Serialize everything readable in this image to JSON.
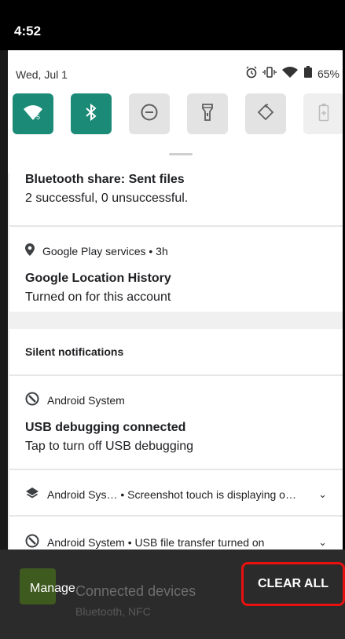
{
  "status_bar": {
    "time": "4:52"
  },
  "quick_settings": {
    "date": "Wed, Jul 1",
    "battery_percent": "65%",
    "tiles": [
      {
        "name": "wifi",
        "icon": "wifi-icon",
        "state": "on"
      },
      {
        "name": "bluetooth",
        "icon": "bluetooth-icon",
        "state": "on"
      },
      {
        "name": "do-not-disturb",
        "icon": "do-not-disturb-icon",
        "state": "off"
      },
      {
        "name": "flashlight",
        "icon": "flashlight-icon",
        "state": "off"
      },
      {
        "name": "auto-rotate",
        "icon": "rotate-icon",
        "state": "off"
      },
      {
        "name": "battery-saver",
        "icon": "battery-saver-icon",
        "state": "disabled"
      }
    ],
    "accent_color": "#1b8a77"
  },
  "notifications": {
    "bluetooth_share": {
      "title": "Bluetooth share: Sent files",
      "text": "2 successful, 0 unsuccessful."
    },
    "google_location": {
      "app": "Google Play services • 3h",
      "title": "Google Location History",
      "text": "Turned on for this account"
    },
    "silent_header": "Silent notifications",
    "usb_debugging": {
      "app": "Android System",
      "title": "USB debugging connected",
      "text": "Tap to turn off USB debugging"
    },
    "screenshot_touch": {
      "app": "Android Sys… • Screenshot touch is displaying o…"
    },
    "usb_transfer": {
      "app": "Android System • USB file transfer turned on"
    }
  },
  "background_tile": {
    "title": "Connected devices",
    "subtitle": "Bluetooth, NFC"
  },
  "footer": {
    "manage_label": "Manage",
    "clear_all_label": "CLEAR ALL",
    "highlight_color": "#e81010"
  }
}
